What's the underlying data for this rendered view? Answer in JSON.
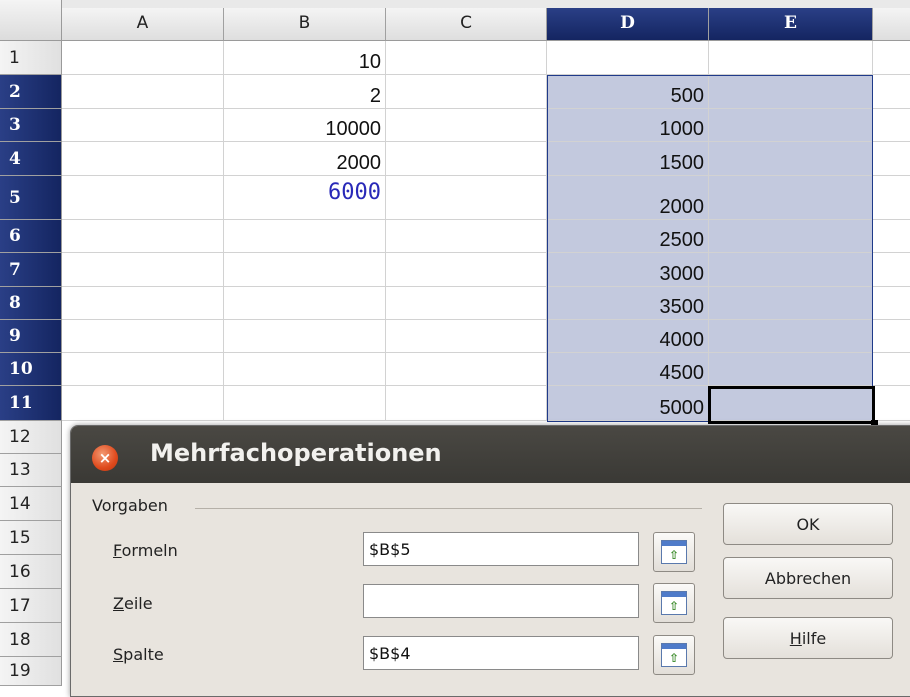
{
  "columns": [
    "A",
    "B",
    "C",
    "D",
    "E"
  ],
  "rows": [
    "1",
    "2",
    "3",
    "4",
    "5",
    "6",
    "7",
    "8",
    "9",
    "10",
    "11",
    "12",
    "13",
    "14",
    "15",
    "16",
    "17",
    "18",
    "19"
  ],
  "col_B": [
    "10",
    "2",
    "10000",
    "2000",
    "6000"
  ],
  "col_D": [
    "500",
    "1000",
    "1500",
    "2000",
    "2500",
    "3000",
    "3500",
    "4000",
    "4500",
    "5000"
  ],
  "dialog": {
    "title": "Mehrfachoperationen",
    "close_glyph": "×",
    "section_label": "Vorgaben",
    "formeln_prefix": "F",
    "formeln_rest": "ormeln",
    "formeln_value": "$B$5",
    "zeile_prefix": "Z",
    "zeile_rest": "eile",
    "zeile_value": "",
    "spalte_prefix": "S",
    "spalte_rest": "palte",
    "spalte_value": "$B$4",
    "ok_label": "OK",
    "cancel_label": "Abbrechen",
    "help_prefix": "H",
    "help_rest": "ilfe",
    "shrink_glyph": "⇧"
  },
  "colors": {
    "selection": "#c3c9de",
    "header_selected": "#1b2d6e",
    "formula_result": "#2929b8",
    "dialog_title": "#3f3e3a"
  }
}
